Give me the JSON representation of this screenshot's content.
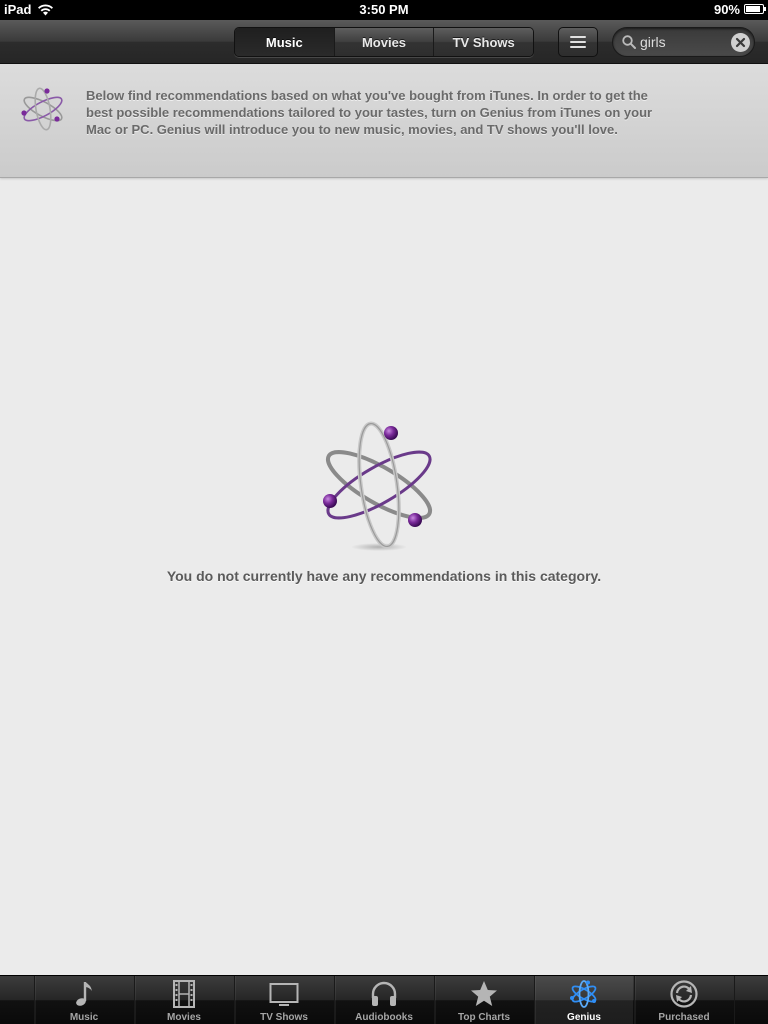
{
  "status_bar": {
    "device": "iPad",
    "time": "3:50 PM",
    "battery_percent": "90%",
    "battery_level": 0.9
  },
  "nav": {
    "segments": [
      {
        "label": "Music",
        "active": true
      },
      {
        "label": "Movies",
        "active": false
      },
      {
        "label": "TV Shows",
        "active": false
      }
    ],
    "search": {
      "value": "girls",
      "placeholder": "Search"
    }
  },
  "banner": {
    "text": "Below find recommendations based on what you've bought from iTunes. In order to get the best possible recommendations tailored to your tastes, turn on Genius from iTunes on your Mac or PC. Genius will introduce you to new music, movies, and TV shows you'll love."
  },
  "empty_state": {
    "message": "You do not currently have any recommendations in this category."
  },
  "tab_bar": {
    "tabs": [
      {
        "label": "Music",
        "icon": "music-note-icon",
        "active": false
      },
      {
        "label": "Movies",
        "icon": "film-icon",
        "active": false
      },
      {
        "label": "TV Shows",
        "icon": "tv-icon",
        "active": false
      },
      {
        "label": "Audiobooks",
        "icon": "headphones-icon",
        "active": false
      },
      {
        "label": "Top Charts",
        "icon": "star-icon",
        "active": false
      },
      {
        "label": "Genius",
        "icon": "genius-atom-icon",
        "active": true
      },
      {
        "label": "Purchased",
        "icon": "purchased-icon",
        "active": false
      }
    ]
  },
  "colors": {
    "genius_purple": "#7a2a9a",
    "active_tab_blue": "#2f8ef5",
    "background": "#ebebeb"
  }
}
